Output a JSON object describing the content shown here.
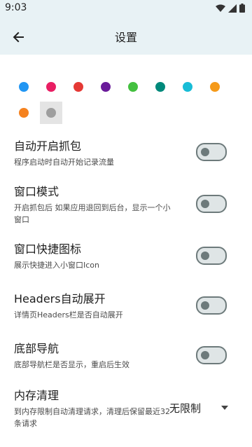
{
  "status": {
    "time": "9:03"
  },
  "header": {
    "title": "设置"
  },
  "theme_colors": [
    "#2196f3",
    "#e91e63",
    "#e53935",
    "#6a1b9a",
    "#43c03f",
    "#00897b",
    "#18bcd6",
    "#f59a1a",
    "#f5821f",
    "#9e9e9e"
  ],
  "settings": {
    "auto_capture": {
      "title": "自动开启抓包",
      "subtitle": "程序启动时自动开始记录流量",
      "enabled": false
    },
    "window_mode": {
      "title": "窗口模式",
      "subtitle": "开启抓包后 如果应用退回到后台，显示一个小窗口",
      "enabled": false
    },
    "window_shortcut": {
      "title": "窗口快捷图标",
      "subtitle": "展示快捷进入小窗口Icon",
      "enabled": false
    },
    "headers_expand": {
      "title": "Headers自动展开",
      "subtitle": "详情页Headers栏是否自动展开",
      "enabled": false
    },
    "bottom_nav": {
      "title": "底部导航",
      "subtitle": "底部导航栏是否显示，重启后生效",
      "enabled": false
    },
    "memory_clean": {
      "title": "内存清理",
      "subtitle": "到内存限制自动清理请求，清理后保留最近32条请求",
      "value": "无限制"
    }
  }
}
